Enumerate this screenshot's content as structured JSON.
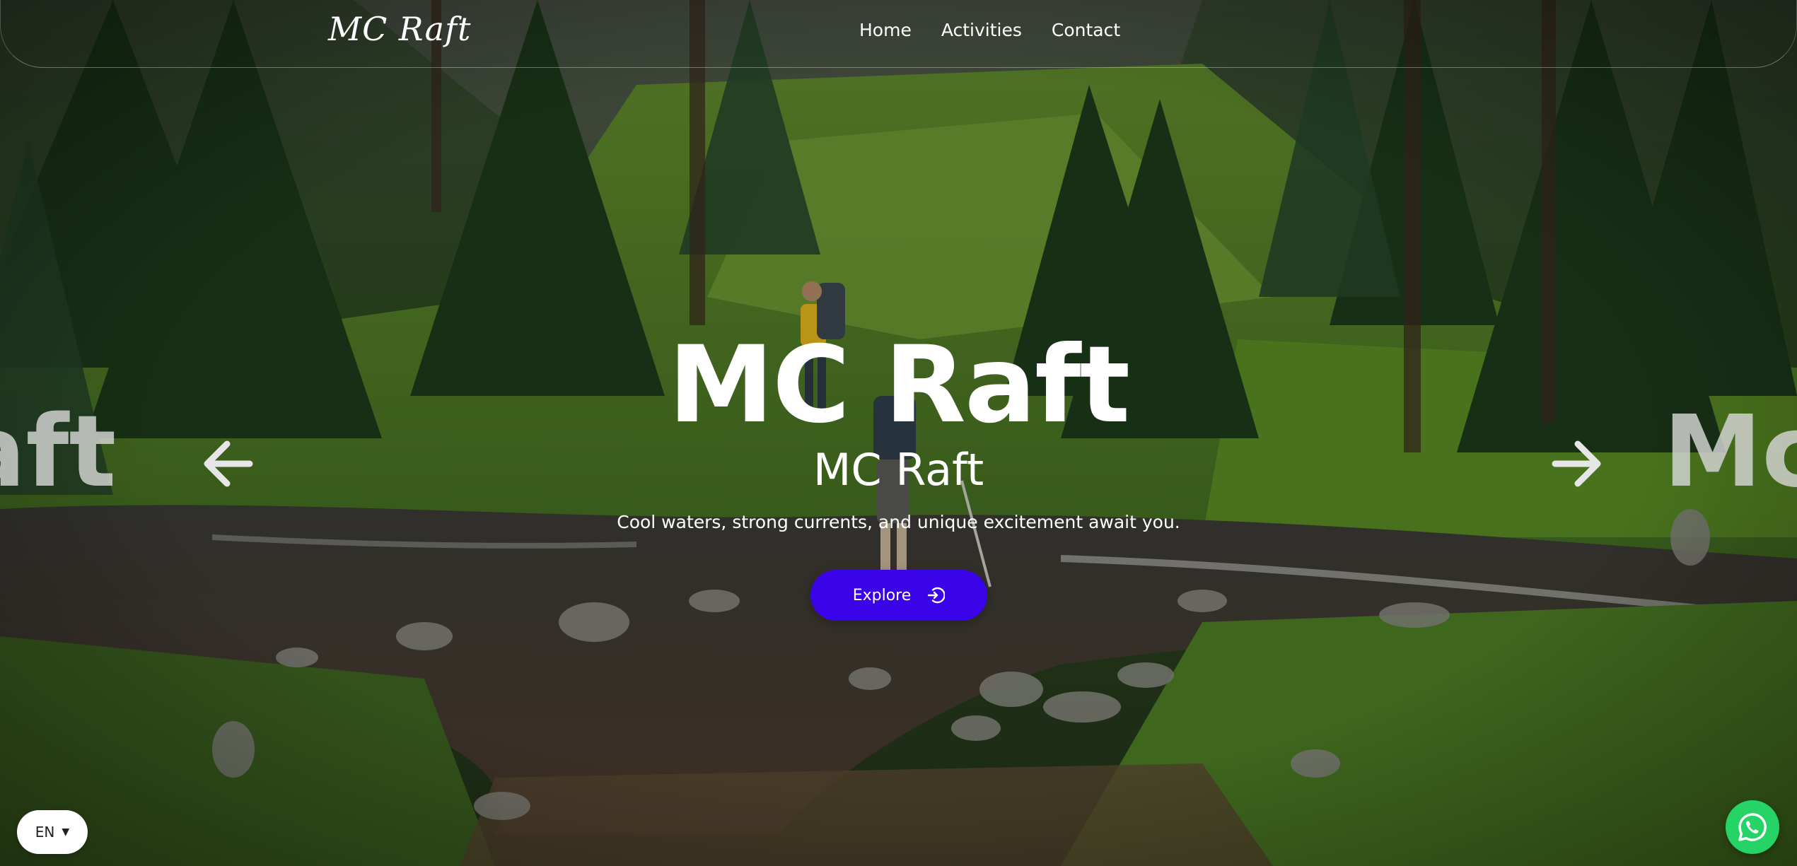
{
  "header": {
    "logo": "MC Raft",
    "nav": [
      {
        "label": "Home"
      },
      {
        "label": "Activities"
      },
      {
        "label": "Contact"
      }
    ]
  },
  "slider": {
    "prev_slide_text": "aft",
    "next_slide_text": "Mc",
    "prev_icon": "arrow-left-icon",
    "next_icon": "arrow-right-icon"
  },
  "hero": {
    "title": "MC Raft",
    "subtitle": "MC Raft",
    "tagline": "Cool waters, strong currents, and unique excitement await you.",
    "cta_label": "Explore",
    "cta_icon": "enter-circle-icon",
    "cta_color": "#3b04e8"
  },
  "language": {
    "current": "EN",
    "caret": "▼"
  },
  "whatsapp": {
    "icon": "whatsapp-icon",
    "color": "#25d366"
  }
}
